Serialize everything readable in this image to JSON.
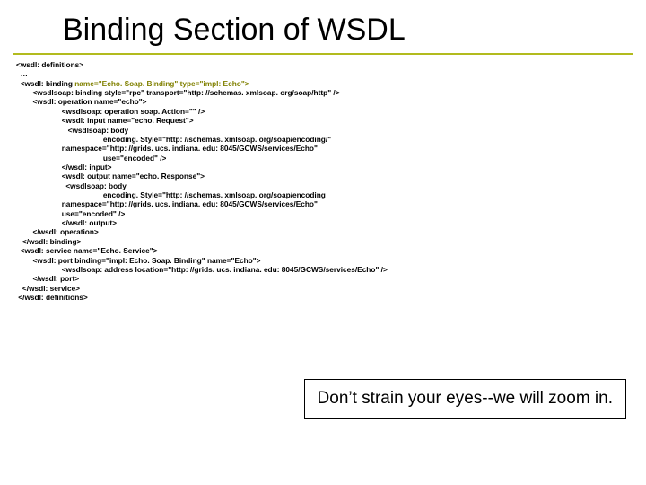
{
  "title": "Binding Section of WSDL",
  "code": {
    "l01": "<wsdl: definitions>",
    "l02": "  …",
    "l03_a": "  <wsdl: binding ",
    "l03_b": "name=\"Echo. Soap. Binding\" type=\"impl: Echo\">",
    "l04": "        <wsdlsoap: binding style=\"rpc\" transport=\"http: //schemas. xmlsoap. org/soap/http\" />",
    "l05": "        <wsdl: operation name=\"echo\">",
    "l06": "                      <wsdlsoap: operation soap. Action=\"\" />",
    "l07": "                      <wsdl: input name=\"echo. Request\">",
    "l08": "                         <wsdlsoap: body",
    "l09": "                                          encoding. Style=\"http: //schemas. xmlsoap. org/soap/encoding/\"",
    "l10": "                      namespace=\"http: //grids. ucs. indiana. edu: 8045/GCWS/services/Echo\"",
    "l11": "                                          use=\"encoded\" />",
    "l12": "                      </wsdl: input>",
    "l13": "                      <wsdl: output name=\"echo. Response\">",
    "l14": "                        <wsdlsoap: body",
    "l15": "                                          encoding. Style=\"http: //schemas. xmlsoap. org/soap/encoding",
    "l16": "                      namespace=\"http: //grids. ucs. indiana. edu: 8045/GCWS/services/Echo\"",
    "l17": "                      use=\"encoded\" />",
    "l18": "                      </wsdl: output>",
    "l19": "        </wsdl: operation>",
    "l20": "   </wsdl: binding>",
    "l21": "  <wsdl: service name=\"Echo. Service\">",
    "l22": "        <wsdl: port binding=\"impl: Echo. Soap. Binding\" name=\"Echo\">",
    "l23": "                      <wsdlsoap: address location=\"http: //grids. ucs. indiana. edu: 8045/GCWS/services/Echo\" />",
    "l24": "        </wsdl: port>",
    "l25": "   </wsdl: service>",
    "l26": " </wsdl: definitions>"
  },
  "caption": "Don’t strain your eyes--we will zoom in."
}
